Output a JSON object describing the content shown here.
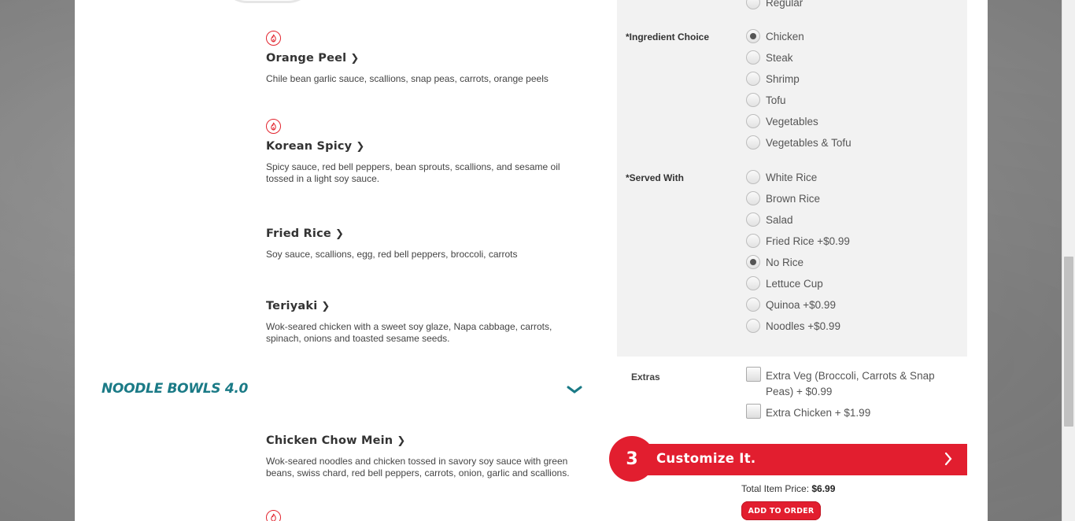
{
  "menu_items": [
    {
      "name": "Orange Peel",
      "desc_lines": [
        "Chile bean garlic sauce, scallions, snap peas, carrots, orange peels"
      ],
      "spicy": true
    },
    {
      "name": "Korean Spicy",
      "desc_lines": [
        "Spicy sauce, red bell peppers, bean sprouts, scallions, and sesame oil",
        "tossed in a light soy sauce."
      ],
      "spicy": true
    },
    {
      "name": "Fried Rice",
      "desc_lines": [
        "Soy sauce, scallions, egg, red bell peppers, broccoli, carrots"
      ],
      "spicy": false
    },
    {
      "name": "Teriyaki",
      "desc_lines": [
        "Wok-seared chicken with a sweet soy glaze, Napa cabbage, carrots,",
        "spinach, onions and toasted sesame seeds."
      ],
      "spicy": false
    }
  ],
  "section": {
    "title": "NOODLE BOWLS 4.0"
  },
  "noodle_items": [
    {
      "name": "Chicken Chow Mein",
      "desc_lines": [
        "Wok-seared noodles and chicken tossed in savory soy sauce with green",
        "beans, swiss chard, red bell peppers, carrots, onion, garlic and scallions."
      ],
      "spicy": false
    }
  ],
  "options": {
    "top_partial": "Regular",
    "ingredient": {
      "label": "*Ingredient Choice",
      "choices": [
        "Chicken",
        "Steak",
        "Shrimp",
        "Tofu",
        "Vegetables",
        "Vegetables & Tofu"
      ],
      "selected": "Chicken"
    },
    "served_with": {
      "label": "*Served With",
      "choices": [
        "White Rice",
        "Brown Rice",
        "Salad",
        "Fried Rice +$0.99",
        "No Rice",
        "Lettuce Cup",
        "Quinoa +$0.99",
        "Noodles +$0.99"
      ],
      "selected": "No Rice"
    },
    "extras": {
      "label": "Extras",
      "items": [
        {
          "lines": [
            "Extra Veg (Broccoli, Carrots & Snap",
            "Peas) + $0.99"
          ]
        },
        {
          "lines": [
            "Extra Chicken + $1.99"
          ]
        }
      ]
    }
  },
  "customize": {
    "step": "3",
    "title": "Customize It."
  },
  "order": {
    "total_label": "Total Item Price:",
    "total_value": "$6.99",
    "button": "ADD TO ORDER"
  },
  "colors": {
    "accent_red": "#e21e2f",
    "section_teal": "#1a7a86",
    "panel_gray": "#f2f2f2"
  }
}
